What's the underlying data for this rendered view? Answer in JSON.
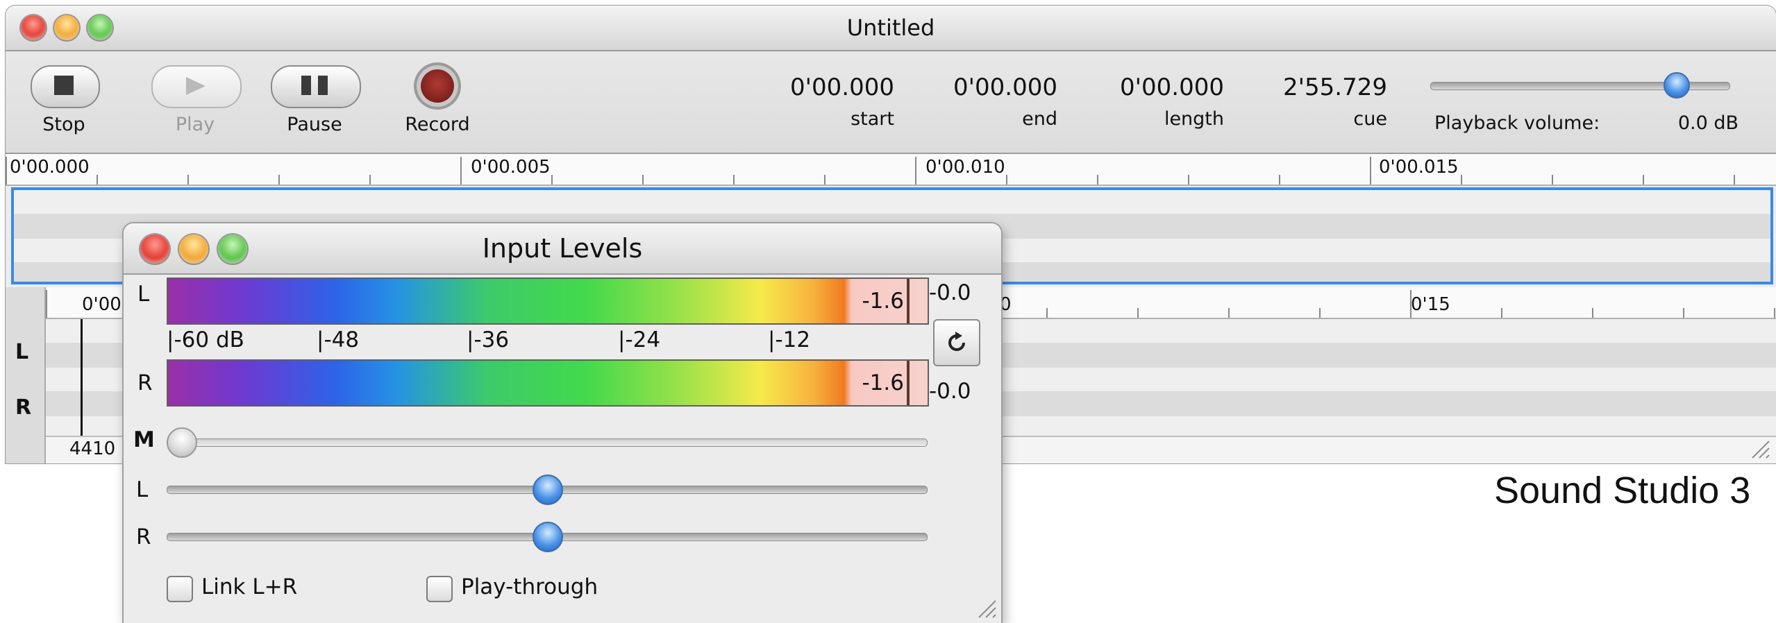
{
  "main_window": {
    "title": "Untitled",
    "toolbar": {
      "stop_label": "Stop",
      "play_label": "Play",
      "pause_label": "Pause",
      "record_label": "Record"
    },
    "readouts": [
      {
        "value": "0'00.000",
        "label": "start"
      },
      {
        "value": "0'00.000",
        "label": "end"
      },
      {
        "value": "0'00.000",
        "label": "length"
      },
      {
        "value": "2'55.729",
        "label": "cue"
      }
    ],
    "playback_volume_label": "Playback volume:",
    "playback_volume_value": "0.0 dB",
    "playback_volume_level": 0.82,
    "top_ruler_labels": [
      "0'00.000",
      "0'00.005",
      "0'00.010",
      "0'00.015"
    ],
    "bottom_ruler_labels": [
      "0'00",
      "0",
      "0'15"
    ],
    "channel_labels": [
      "L",
      "R"
    ],
    "sample_rate_partial": "4410"
  },
  "input_levels": {
    "title": "Input Levels",
    "left_label": "L",
    "right_label": "R",
    "left_meter_value": "-1.6",
    "right_meter_value": "-1.6",
    "left_peak": "-0.0",
    "right_peak": "-0.0",
    "scale": [
      "-60 dB",
      "-48",
      "-36",
      "-24",
      "-12"
    ],
    "monitor_label": "M",
    "gain_left_label": "L",
    "gain_right_label": "R",
    "monitor_level": 0.0,
    "gain_left_level": 0.5,
    "gain_right_level": 0.5,
    "link_label": "Link L+R",
    "playthrough_label": "Play-through"
  },
  "caption": "Sound Studio 3",
  "colors": {
    "selection_blue": "#3a8ae6",
    "record_red": "#8b2a26"
  }
}
